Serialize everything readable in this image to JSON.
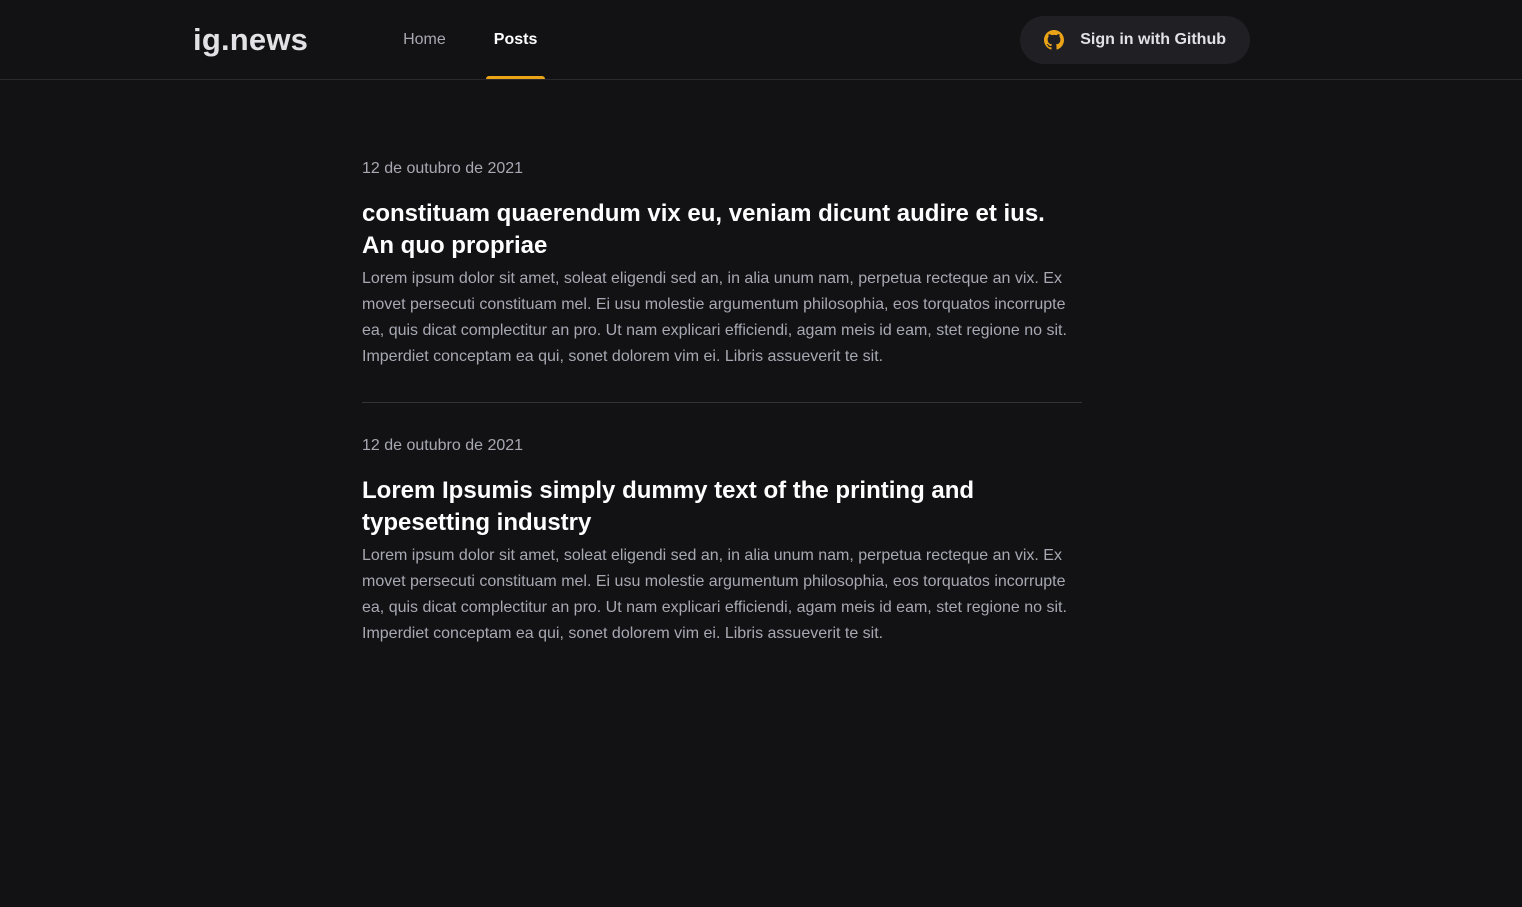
{
  "header": {
    "logo": "ig.news",
    "nav": {
      "home": "Home",
      "posts": "Posts",
      "active": "posts"
    },
    "signin": {
      "label": "Sign in with Github",
      "icon": "github-icon",
      "icon_color": "#eba417"
    }
  },
  "colors": {
    "background": "#121214",
    "accent": "#eba417",
    "button_bg": "#202024",
    "text_muted": "#a8a8b3",
    "divider": "#323238"
  },
  "posts": [
    {
      "date": "12 de outubro de 2021",
      "title": "constituam quaerendum vix eu, veniam dicunt audire et ius. An quo propriae",
      "excerpt": "Lorem ipsum dolor sit amet, soleat eligendi sed an, in alia unum nam, perpetua recteque an vix. Ex movet persecuti constituam mel. Ei usu molestie argumentum philosophia, eos torquatos incorrupte ea, quis dicat complectitur an pro. Ut nam explicari efficiendi, agam meis id eam, stet regione no sit. Imperdiet conceptam ea qui, sonet dolorem vim ei. Libris assueverit te sit."
    },
    {
      "date": "12 de outubro de 2021",
      "title": "Lorem Ipsumis simply dummy text of the printing and typesetting industry",
      "excerpt": "Lorem ipsum dolor sit amet, soleat eligendi sed an, in alia unum nam, perpetua recteque an vix. Ex movet persecuti constituam mel. Ei usu molestie argumentum philosophia, eos torquatos incorrupte ea, quis dicat complectitur an pro. Ut nam explicari efficiendi, agam meis id eam, stet regione no sit. Imperdiet conceptam ea qui, sonet dolorem vim ei. Libris assueverit te sit."
    }
  ]
}
